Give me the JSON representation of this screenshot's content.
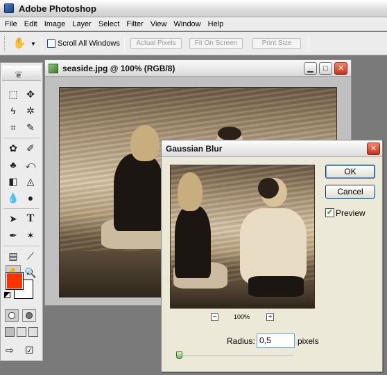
{
  "app": {
    "title": "Adobe Photoshop"
  },
  "menu": [
    "File",
    "Edit",
    "Image",
    "Layer",
    "Select",
    "Filter",
    "View",
    "Window",
    "Help"
  ],
  "options_bar": {
    "scroll_all_label": "Scroll All Windows",
    "scroll_all_checked": false,
    "buttons": [
      "Actual Pixels",
      "Fit On Screen",
      "Print Size"
    ]
  },
  "toolbox": {
    "foreground_color": "#ff3300",
    "background_color": "#ffffff"
  },
  "document": {
    "title": "seaside.jpg @ 100% (RGB/8)",
    "controls": {
      "minimize": "▁",
      "maximize": "□",
      "close": "✕"
    }
  },
  "dialog": {
    "title": "Gaussian Blur",
    "close": "✕",
    "ok_label": "OK",
    "cancel_label": "Cancel",
    "preview_label": "Preview",
    "preview_checked": "✔",
    "zoom_minus": "−",
    "zoom_plus": "+",
    "zoom_label": "100%",
    "radius_label": "Radius:",
    "radius_value": "0,5",
    "unit_label": "pixels",
    "slider_position": 0.02
  }
}
